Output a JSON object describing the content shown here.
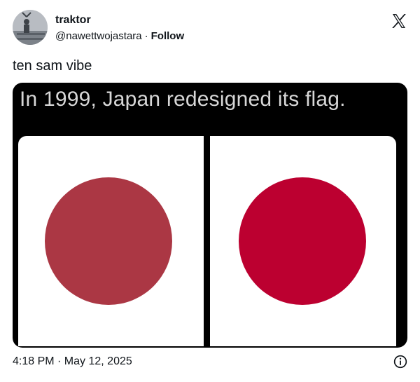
{
  "author": {
    "display_name": "traktor",
    "handle": "@nawettwojastara",
    "separator": "·",
    "follow_label": "Follow"
  },
  "tweet": {
    "text": "ten sam vibe"
  },
  "media": {
    "caption": "In 1999, Japan redesigned its flag.",
    "colors": {
      "old_disc": "#ab3744",
      "new_disc": "#bc0030",
      "background": "#000000",
      "panel": "#ffffff"
    }
  },
  "footer": {
    "timestamp": "4:18 PM · May 12, 2025"
  },
  "icons": {
    "brand": "x-logo-icon",
    "info": "info-icon"
  }
}
